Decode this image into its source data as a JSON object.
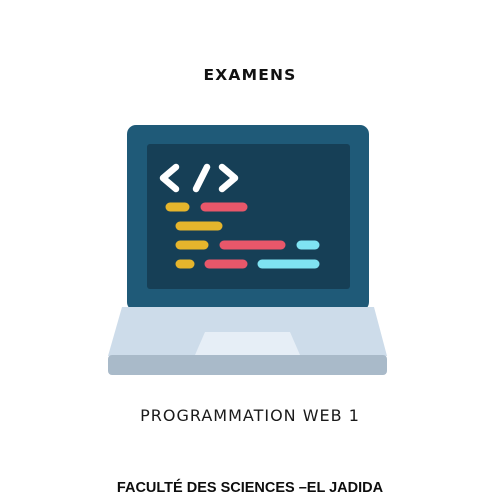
{
  "header": {
    "title": "EXAMENS"
  },
  "course": {
    "name": "PROGRAMMATION WEB 1"
  },
  "footer": {
    "institution": "FACULTÉ DES SCIENCES –EL JADIDA"
  },
  "illustration": {
    "icon": "laptop-code-icon",
    "colors": {
      "lid": "#1f5a78",
      "screen": "#163f56",
      "base": "#cddcea",
      "base_edge": "#a9bac9",
      "trackpad": "#e6eef6",
      "glyph": "#ffffff",
      "code_yellow": "#e5b52c",
      "code_red": "#e8576a",
      "code_cyan": "#7fe3f2"
    }
  }
}
